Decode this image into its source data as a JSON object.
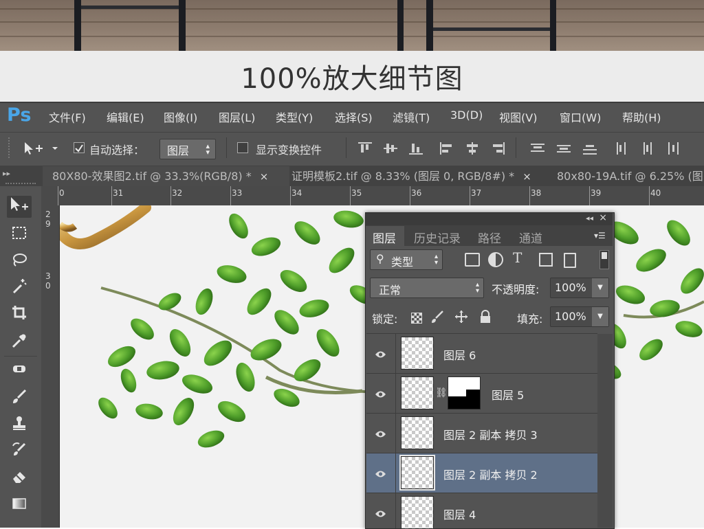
{
  "banner": {
    "caption": "100%放大细节图"
  },
  "app": {
    "logo": "Ps"
  },
  "menubar": {
    "items": [
      "文件(F)",
      "编辑(E)",
      "图像(I)",
      "图层(L)",
      "类型(Y)",
      "选择(S)",
      "滤镜(T)",
      "3D(D)",
      "视图(V)",
      "窗口(W)",
      "帮助(H)"
    ]
  },
  "options_bar": {
    "auto_select_label": "自动选择：",
    "auto_select_target": "图层",
    "show_transform_label": "显示变换控件"
  },
  "tabs": [
    {
      "title": "80X80-效果图2.tif @ 33.3%(RGB/8) *",
      "close": "×"
    },
    {
      "title": "证明模板2.tif @ 8.33% (图层 0, RGB/8#) *",
      "close": "×"
    },
    {
      "title": "80x80-19A.tif @ 6.25% (图",
      "close": ""
    }
  ],
  "ruler": {
    "h_ticks": [
      "0",
      "31",
      "32",
      "33",
      "34",
      "35",
      "36",
      "37",
      "38",
      "39",
      "40"
    ],
    "v_ticks": [
      "2",
      "9",
      "3",
      "0"
    ]
  },
  "layers_panel": {
    "tabs": [
      "图层",
      "历史记录",
      "路径",
      "通道"
    ],
    "filter_kind": "类型",
    "blend_mode": "正常",
    "opacity_label": "不透明度:",
    "opacity_value": "100%",
    "lock_label": "锁定:",
    "fill_label": "填充:",
    "fill_value": "100%",
    "layers": [
      {
        "name": "图层 6",
        "selected": false,
        "has_mask": false
      },
      {
        "name": "图层 5",
        "selected": false,
        "has_mask": true
      },
      {
        "name": "图层 2 副本 拷贝 3",
        "selected": false,
        "has_mask": false
      },
      {
        "name": "图层 2 副本 拷贝 2",
        "selected": true,
        "has_mask": false
      },
      {
        "name": "图层 4",
        "selected": false,
        "has_mask": false
      }
    ]
  },
  "icons": {
    "tools": [
      "move-tool-icon",
      "marquee-tool-icon",
      "lasso-tool-icon",
      "magic-wand-icon",
      "crop-tool-icon",
      "eyedropper-icon",
      "healing-brush-icon",
      "brush-tool-icon",
      "clone-stamp-icon",
      "history-brush-icon",
      "eraser-icon",
      "gradient-icon"
    ]
  },
  "colors": {
    "ps_blue": "#4aa6e8",
    "panel_bg": "#535353",
    "selected_layer": "#5f7088",
    "leaf_green": "#4f9e2a"
  }
}
